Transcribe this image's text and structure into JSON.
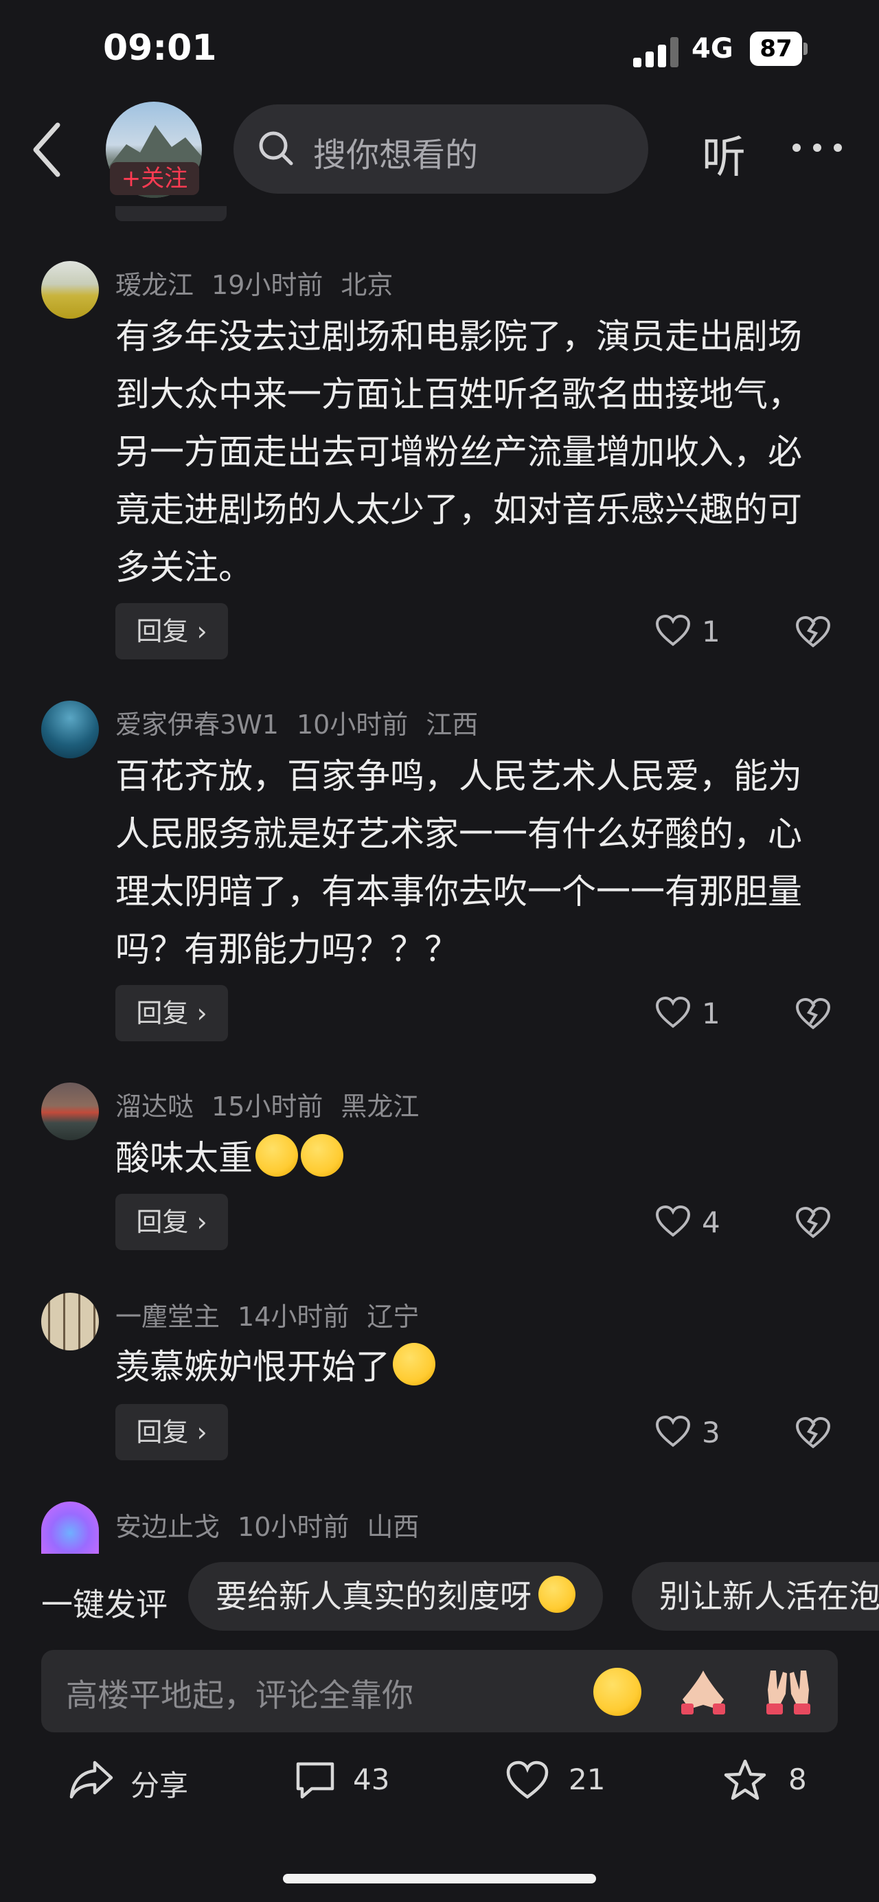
{
  "status_bar": {
    "time": "09:01",
    "network": "4G",
    "battery": "87"
  },
  "header": {
    "follow_label": "+关注",
    "search_placeholder": "搜你想看的",
    "listen_label": "听"
  },
  "comments": [
    {
      "user": "瑷龙江",
      "time": "19小时前",
      "location": "北京",
      "text": "有多年没去过剧场和电影院了，演员走出剧场到大众中来一方面让百姓听名歌名曲接地气，另一方面走出去可增粉丝产流量增加收入，必竟走进剧场的人太少了，如对音乐感兴趣的可多关注。",
      "reply": "回复",
      "likes": "1"
    },
    {
      "user": "爱家伊春3W1",
      "time": "10小时前",
      "location": "江西",
      "text": "百花齐放，百家争鸣，人民艺术人民爱，能为人民服务就是好艺术家一一有什么好酸的，心理太阴暗了，有本事你去吹一个一一有那胆量吗？有那能力吗？？？",
      "reply": "回复",
      "likes": "1"
    },
    {
      "user": "溜达哒",
      "time": "15小时前",
      "location": "黑龙江",
      "text": "酸味太重",
      "reply": "回复",
      "likes": "4"
    },
    {
      "user": "一麈堂主",
      "time": "14小时前",
      "location": "辽宁",
      "text": "羡慕嫉妒恨开始了",
      "reply": "回复",
      "likes": "3"
    },
    {
      "user": "安边止戈",
      "time": "10小时前",
      "location": "山西"
    }
  ],
  "quick_comment": {
    "label": "一键发评",
    "chips": [
      "要给新人真实的刻度呀",
      "别让新人活在泡"
    ]
  },
  "input": {
    "placeholder": "高楼平地起，评论全靠你"
  },
  "bottom_bar": {
    "share": "分享",
    "comments": "43",
    "likes": "21",
    "favorites": "8"
  }
}
